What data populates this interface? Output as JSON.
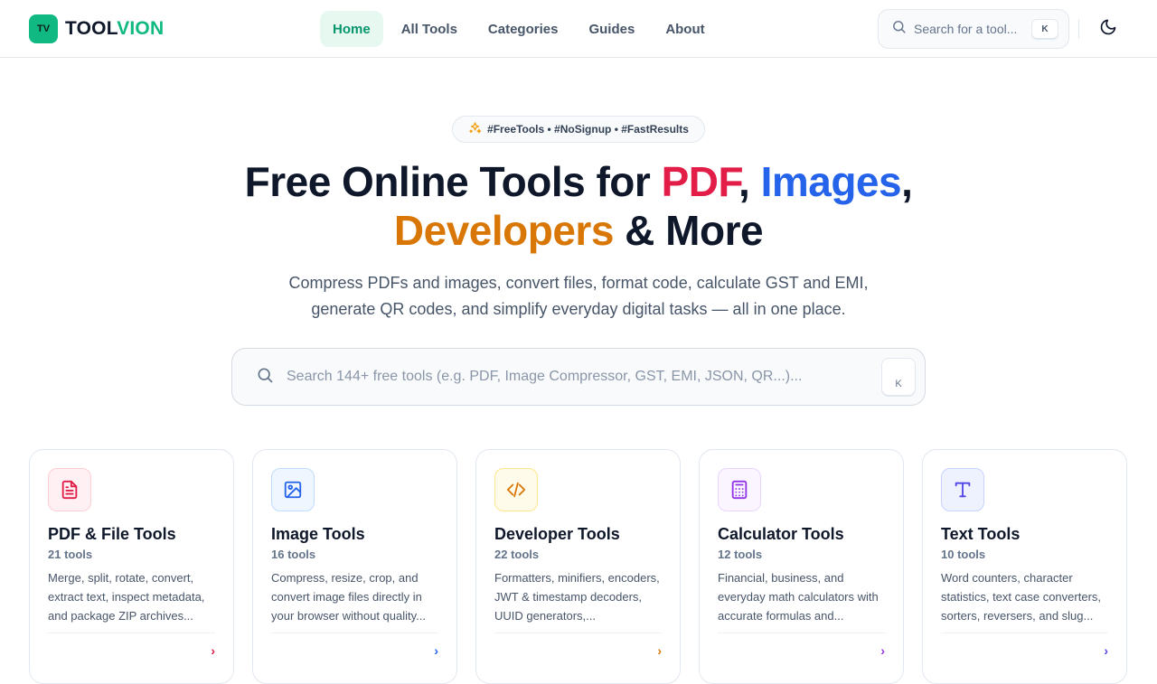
{
  "brand": {
    "mark": "TV",
    "name_part1": "TOOL",
    "name_part2": "VION",
    "accent_color": "#10b981"
  },
  "nav": {
    "items": [
      {
        "label": "Home",
        "active": true
      },
      {
        "label": "All Tools",
        "active": false
      },
      {
        "label": "Categories",
        "active": false
      },
      {
        "label": "Guides",
        "active": false
      },
      {
        "label": "About",
        "active": false
      }
    ]
  },
  "header_search": {
    "placeholder": "Search for a tool...",
    "shortcut": "K"
  },
  "theme_toggle": {
    "icon": "moon-icon"
  },
  "hero": {
    "badge_icon": "sparkles-icon",
    "badge": "#FreeTools • #NoSignup • #FastResults",
    "title_part1": "Free Online Tools for ",
    "title_pdf": "PDF",
    "title_comma1": ", ",
    "title_images": "Images",
    "title_comma2": ",",
    "title_developers": "Developers",
    "title_part2": " & More",
    "subtitle_line1": "Compress PDFs and images, convert files, format code, calculate GST and EMI,",
    "subtitle_line2": "generate QR codes, and simplify everyday digital tasks — all in one place.",
    "colors": {
      "pdf": "#e11d48",
      "images": "#2563eb",
      "developers": "#d97706"
    }
  },
  "main_search": {
    "placeholder": "Search 144+ free tools (e.g. PDF, Image Compressor, GST, EMI, JSON, QR...)...",
    "shortcut": "K"
  },
  "categories": [
    {
      "title": "PDF & File Tools",
      "count": "21 tools",
      "description": "Merge, split, rotate, convert, extract text, inspect metadata, and package ZIP archives...",
      "icon": "file-text-icon",
      "color": "#e11d48",
      "bg": "#fff1f3",
      "border": "#fecdd3"
    },
    {
      "title": "Image Tools",
      "count": "16 tools",
      "description": "Compress, resize, crop, and convert image files directly in your browser without quality...",
      "icon": "image-icon",
      "color": "#2563eb",
      "bg": "#eff6ff",
      "border": "#bfdbfe"
    },
    {
      "title": "Developer Tools",
      "count": "22 tools",
      "description": "Formatters, minifiers, encoders, JWT & timestamp decoders, UUID generators,...",
      "icon": "code-icon",
      "color": "#d97706",
      "bg": "#fffbeb",
      "border": "#fde68a"
    },
    {
      "title": "Calculator Tools",
      "count": "12 tools",
      "description": "Financial, business, and everyday math calculators with accurate formulas and...",
      "icon": "calculator-icon",
      "color": "#9333ea",
      "bg": "#faf5ff",
      "border": "#e9d5ff"
    },
    {
      "title": "Text Tools",
      "count": "10 tools",
      "description": "Word counters, character statistics, text case converters, sorters, reversers, and slug...",
      "icon": "type-icon",
      "color": "#4f46e5",
      "bg": "#eef2ff",
      "border": "#c7d2fe"
    }
  ]
}
